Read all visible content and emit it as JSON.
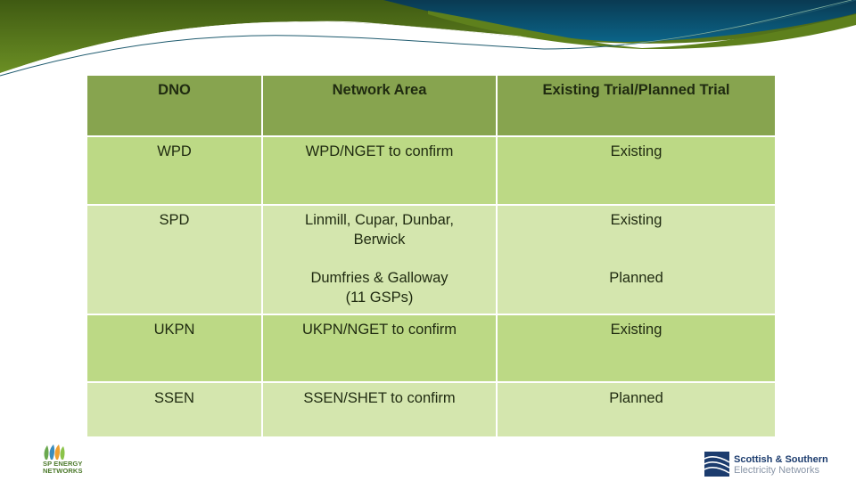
{
  "table": {
    "headers": [
      "DNO",
      "Network Area",
      "Existing Trial/Planned Trial"
    ],
    "rows": [
      {
        "dno": "WPD",
        "area": "WPD/NGET to confirm",
        "trial": "Existing"
      },
      {
        "dno": "SPD",
        "area_1": "Linmill, Cupar, Dunbar,",
        "area_2": "Berwick",
        "area_3": "Dumfries & Galloway",
        "area_4": "(11 GSPs)",
        "trial_1": "Existing",
        "trial_2": "Planned"
      },
      {
        "dno": "UKPN",
        "area": "UKPN/NGET to confirm",
        "trial": "Existing"
      },
      {
        "dno": "SSEN",
        "area": "SSEN/SHET to confirm",
        "trial": "Planned"
      }
    ]
  },
  "logos": {
    "sp_energy": {
      "line1": "SP ENERGY",
      "line2": "NETWORKS",
      "icon": "leaves-icon"
    },
    "sse": {
      "line1": "Scottish & Southern",
      "line2": "Electricity Networks",
      "icon": "wave-mark-icon"
    }
  },
  "colors": {
    "header_bg": "#87a44f",
    "row_dark": "#bcd985",
    "row_light": "#d4e6ae",
    "banner_green": "#5a7d1e",
    "banner_blue": "#0b5a7c"
  }
}
